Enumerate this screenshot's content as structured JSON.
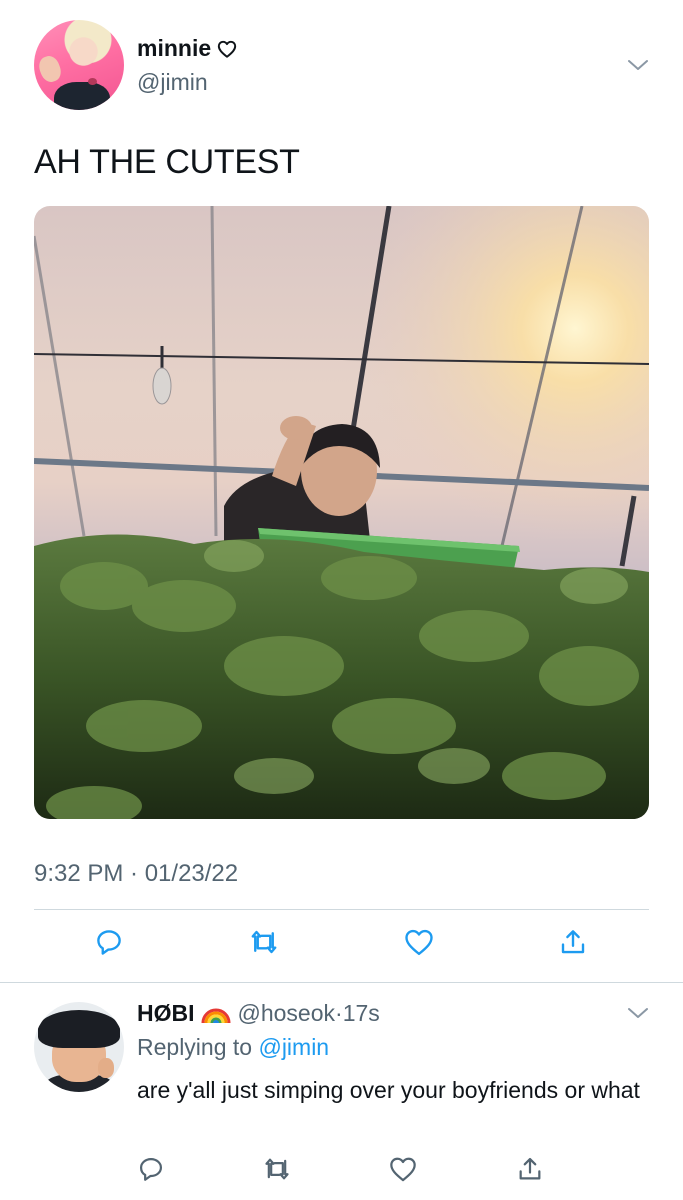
{
  "main_tweet": {
    "display_name": "minnie",
    "name_icon": "heart-outline-icon",
    "handle": "@jimin",
    "text": "AH THE CUTEST",
    "timestamp": "9:32 PM · 01/23/22",
    "photo_icon": "photo",
    "actions": [
      "reply-icon",
      "retweet-icon",
      "like-icon",
      "share-icon"
    ]
  },
  "reply": {
    "display_name": "HØBI",
    "name_icon": "rainbow-icon",
    "handle": "@hoseok",
    "dot": "·",
    "time": "17s",
    "replying_prefix": "Replying to",
    "replying_to": "@jimin",
    "text": "are y'all just simping over your boyfriends or what",
    "actions": [
      "reply-icon",
      "retweet-icon",
      "like-icon",
      "share-icon"
    ]
  },
  "colors": {
    "text": "#0f1419",
    "secondary": "#536471",
    "link": "#1d9bf0",
    "divider": "#cfd9de"
  }
}
